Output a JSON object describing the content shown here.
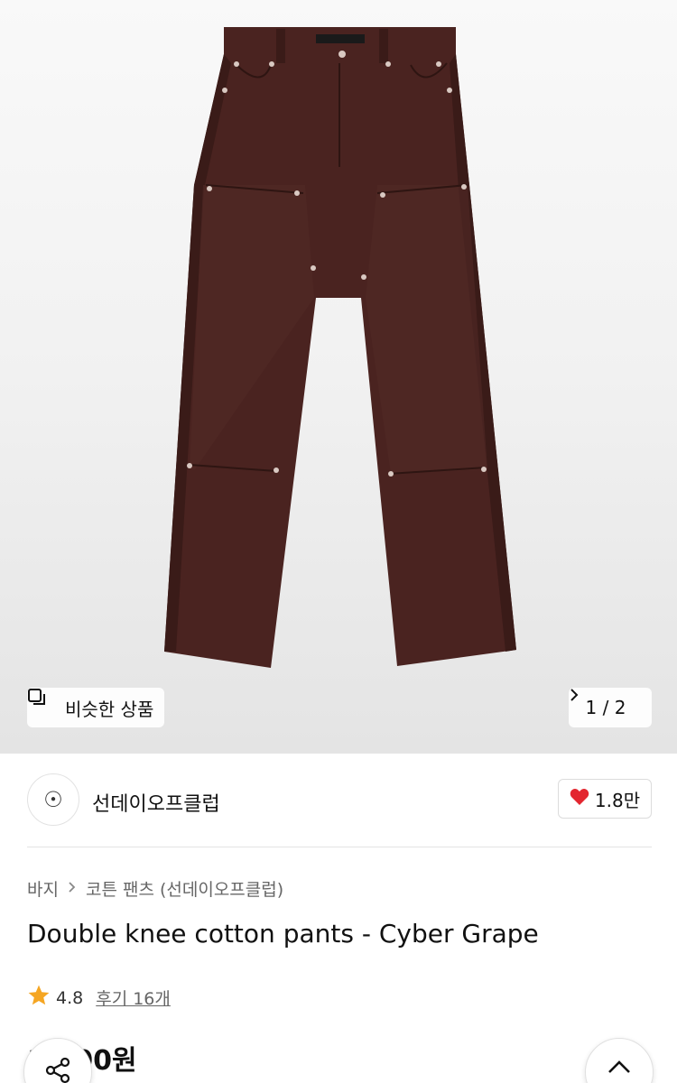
{
  "hero": {
    "similar_label": "비슷한 상품",
    "page_indicator": "1 / 2",
    "image_alt_icon": "pants-photo"
  },
  "brand": {
    "logo_glyph": "☉",
    "name": "선데이오프클럽",
    "likes": "1.8만"
  },
  "breadcrumb": {
    "items": [
      "바지",
      "코튼 팬츠 (선데이오프클럽)"
    ]
  },
  "product": {
    "title": "Double knee cotton pants - Cyber Grape",
    "rating": "4.8",
    "review_text": "후기 16개",
    "price": "1 000원"
  },
  "colors": {
    "pants": "#4a2320",
    "star": "#f5a623",
    "heart": "#e3262f"
  },
  "icons": {
    "similar": "copy-icon",
    "next": "chevron-right-icon",
    "like": "heart-icon",
    "star": "star-icon",
    "share": "share-icon",
    "top": "chevron-up-icon"
  }
}
